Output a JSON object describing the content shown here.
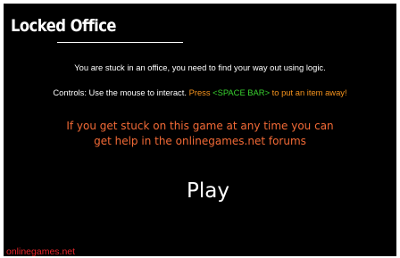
{
  "title": "Locked Office",
  "intro_text": "You are stuck in an office, you need to find your way out using logic.",
  "controls": {
    "prefix": "Controls: Use the mouse to interact.",
    "press": "Press",
    "key": "<SPACE BAR>",
    "suffix": "to put an item away!"
  },
  "help": {
    "line1": "If you get stuck on this game at any time you can",
    "line2": "get help in the onlinegames.net forums"
  },
  "play_label": "Play",
  "brand": "onlinegames.net",
  "colors": {
    "background": "#000000",
    "text": "#ffffff",
    "accent_orange": "#f7941d",
    "key_green": "#39d22f",
    "help_orange": "#f26a36",
    "brand_red": "#e8262b"
  }
}
